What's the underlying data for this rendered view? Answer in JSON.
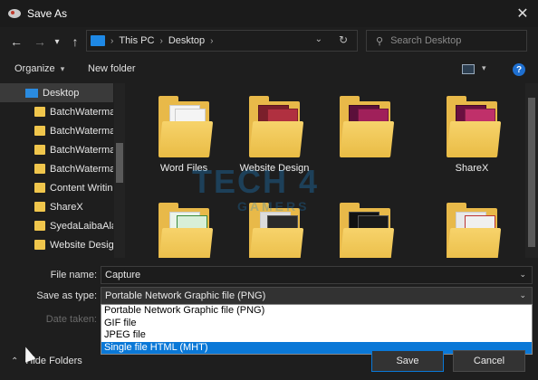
{
  "window": {
    "title": "Save As",
    "close_glyph": "✕"
  },
  "nav": {
    "back_glyph": "←",
    "forward_glyph": "→",
    "dropdown_glyph": "▾",
    "up_glyph": "↑",
    "breadcrumb": [
      "This PC",
      "Desktop"
    ],
    "breadcrumb_sep": "›",
    "addr_drop_glyph": "⌄",
    "refresh_glyph": "↻",
    "search_glyph": "⚲",
    "search_placeholder": "Search Desktop"
  },
  "toolbar": {
    "organize_label": "Organize",
    "organize_drop": "▾",
    "new_folder_label": "New folder",
    "view_drop": "▾",
    "help_label": "?"
  },
  "sidebar": {
    "items": [
      {
        "label": "Desktop",
        "icon": "desktop-icon",
        "selected": true
      },
      {
        "label": "BatchWaterma"
      },
      {
        "label": "BatchWaterma"
      },
      {
        "label": "BatchWaterma"
      },
      {
        "label": "BatchWaterma"
      },
      {
        "label": "Content Writin"
      },
      {
        "label": "ShareX"
      },
      {
        "label": "SyedaLaibaAla"
      },
      {
        "label": "Website Desigr"
      }
    ]
  },
  "content": {
    "folders": [
      {
        "label": "Word Files"
      },
      {
        "label": "Website Design"
      },
      {
        "label": ""
      },
      {
        "label": "ShareX"
      },
      {
        "label": ""
      },
      {
        "label": ""
      },
      {
        "label": ""
      },
      {
        "label": ""
      }
    ]
  },
  "watermark": {
    "main": "TECH 4",
    "sub": "GAMERS"
  },
  "form": {
    "file_name_label": "File name:",
    "file_name_value": "Capture",
    "save_type_label": "Save as type:",
    "save_type_value": "Portable Network Graphic file (PNG)",
    "date_taken_label": "Date taken:",
    "drop_glyph": "⌄",
    "options": [
      "Portable Network Graphic file (PNG)",
      "GIF file",
      "JPEG file",
      "Single file HTML (MHT)"
    ],
    "highlighted_option": "Single file HTML (MHT)"
  },
  "footer": {
    "hide_folders_label": "Hide Folders",
    "chevron": "⌃",
    "save_label": "Save",
    "cancel_label": "Cancel"
  },
  "colors": {
    "accent": "#0a78d7",
    "folder": "#e8b949",
    "background": "#1e1e1e"
  }
}
